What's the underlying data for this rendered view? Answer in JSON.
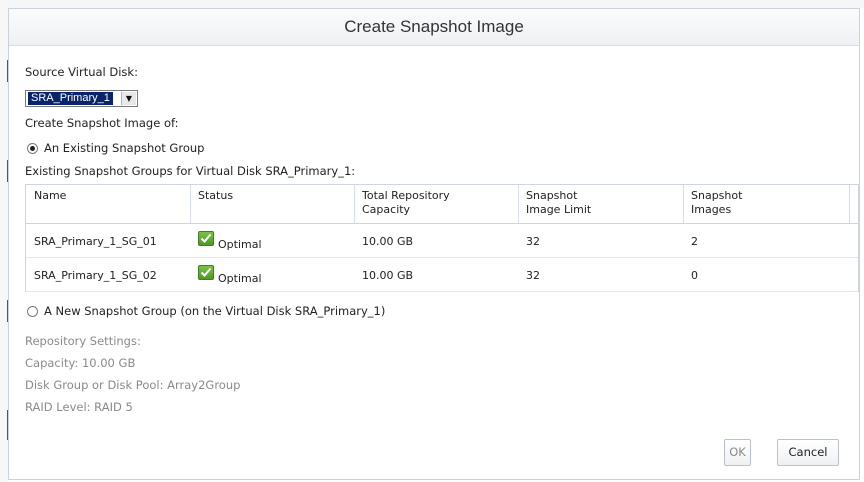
{
  "dialog": {
    "title": "Create Snapshot Image"
  },
  "source": {
    "label": "Source Virtual Disk:",
    "selected": "SRA_Primary_1"
  },
  "create_of_label": "Create Snapshot Image of:",
  "option_existing": {
    "label": "An Existing Snapshot Group",
    "selected": true
  },
  "groups_caption": "Existing Snapshot Groups for Virtual Disk SRA_Primary_1:",
  "table": {
    "headers": {
      "name": "Name",
      "status": "Status",
      "capacity_1": "Total Repository",
      "capacity_2": "Capacity",
      "limit_1": "Snapshot",
      "limit_2": "Image Limit",
      "images_1": "Snapshot",
      "images_2": "Images"
    },
    "rows": [
      {
        "name": "SRA_Primary_1_SG_01",
        "status": "Optimal",
        "capacity": "10.00 GB",
        "limit": "32",
        "images": "2"
      },
      {
        "name": "SRA_Primary_1_SG_02",
        "status": "Optimal",
        "capacity": "10.00 GB",
        "limit": "32",
        "images": "0"
      }
    ]
  },
  "option_new": {
    "label": "A New Snapshot Group (on the Virtual Disk SRA_Primary_1)",
    "selected": false
  },
  "repository": {
    "heading": "Repository Settings:",
    "capacity": "Capacity: 10.00 GB",
    "pool": "Disk Group or Disk Pool: Array2Group",
    "raid": "RAID Level: RAID 5"
  },
  "buttons": {
    "ok": "OK",
    "cancel": "Cancel"
  },
  "colors": {
    "status_ok": "#4c9a22",
    "selection": "#0a246a"
  }
}
